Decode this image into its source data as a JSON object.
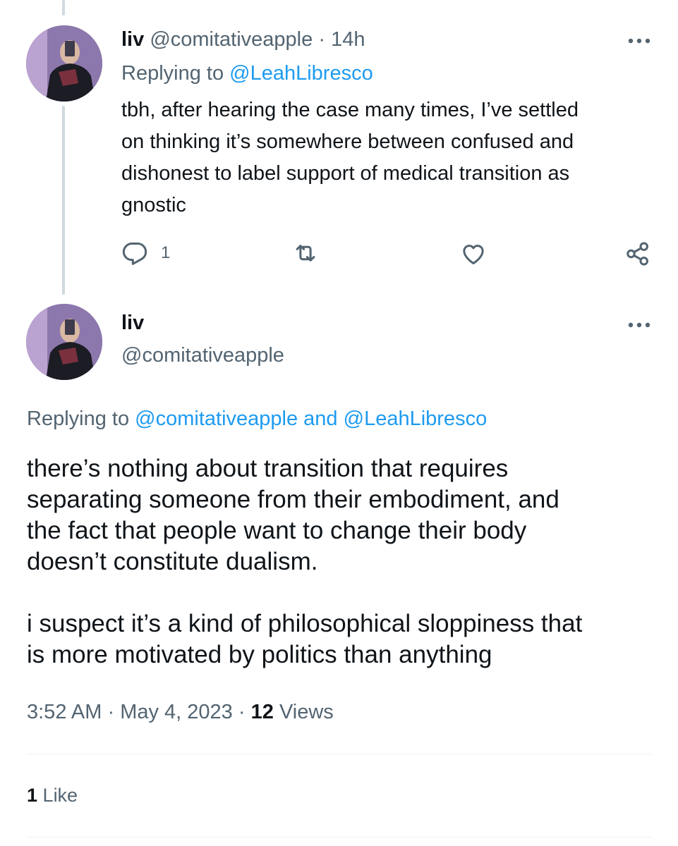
{
  "parent_tweet": {
    "display_name": "liv",
    "handle": "@comitativeapple",
    "separator": "·",
    "time": "14h",
    "replying_to_label": "Replying to",
    "replying_to_handle": "@LeahLibresco",
    "text_lines": [
      "tbh, after hearing the case many times, I’ve settled",
      "on thinking it’s somewhere between confused and",
      "dishonest to label support of medical transition as",
      "gnostic"
    ],
    "reply_count": "1",
    "icons": {
      "more": "more-horizontal-icon",
      "reply": "reply-icon",
      "retweet": "retweet-icon",
      "like": "like-icon",
      "share": "share-icon"
    }
  },
  "main_tweet": {
    "display_name": "liv",
    "handle": "@comitativeapple",
    "replying_to_label": "Replying to",
    "replying_to_handle_1": "@comitativeapple",
    "replying_to_and": "and",
    "replying_to_handle_2": "@LeahLibresco",
    "paragraph_1_lines": [
      "there’s nothing about transition that requires",
      "separating someone from their embodiment, and",
      "the fact that people want to change their body",
      "doesn’t constitute dualism."
    ],
    "paragraph_2_lines": [
      "i suspect it’s a kind of philosophical sloppiness that",
      "is more motivated by politics than anything"
    ],
    "time": "3:52 AM",
    "separator": "·",
    "date": "May 4, 2023",
    "views_count": "12",
    "views_label": "Views",
    "likes_count": "1",
    "likes_label": "Like"
  },
  "colors": {
    "text": "#0f1419",
    "muted": "#536471",
    "link": "#1d9bf0",
    "thread_line": "#cfd9de",
    "divider": "#eff3f4"
  }
}
